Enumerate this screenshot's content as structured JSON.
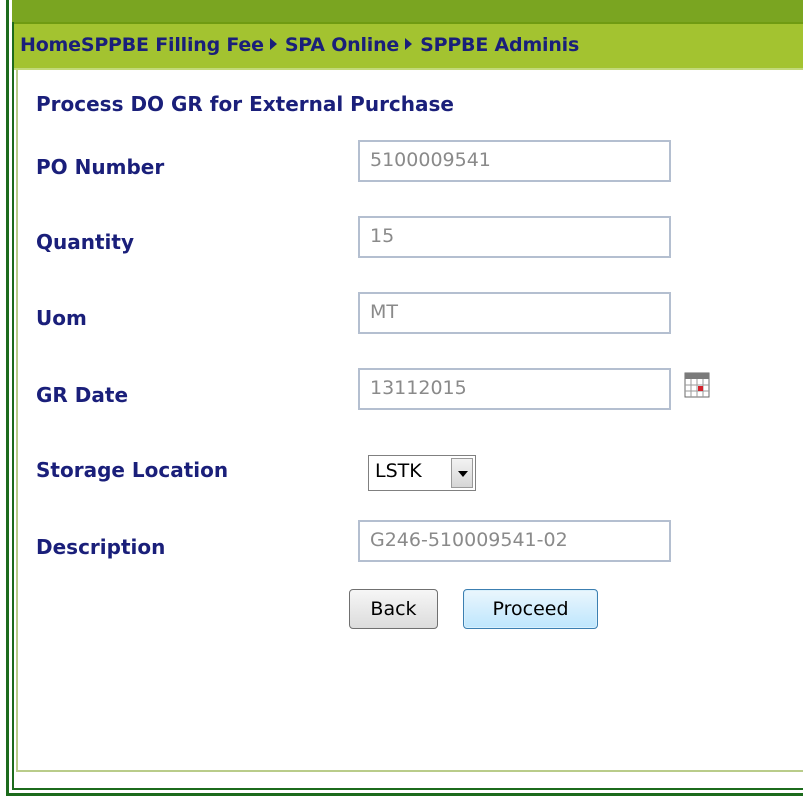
{
  "breadcrumb": {
    "items": [
      "Home",
      "SPPBE Filling Fee",
      "SPA Online",
      "SPPBE Adminis"
    ]
  },
  "page": {
    "title": "Process DO GR for External Purchase"
  },
  "form": {
    "po_number": {
      "label": "PO Number",
      "value": "5100009541"
    },
    "quantity": {
      "label": "Quantity",
      "value": "15"
    },
    "uom": {
      "label": "Uom",
      "value": "MT"
    },
    "gr_date": {
      "label": "GR Date",
      "value": "13112015",
      "icon": "calendar-icon"
    },
    "storage_location": {
      "label": "Storage Location",
      "selected": "LSTK"
    },
    "description": {
      "label": "Description",
      "value": "G246-510009541-02"
    }
  },
  "buttons": {
    "back": "Back",
    "proceed": "Proceed"
  },
  "colors": {
    "label_text": "#1a1f7a",
    "breadcrumb_bar": "#a3c330",
    "frame_border": "#1c6b1c",
    "input_text": "#8a8a8a"
  }
}
